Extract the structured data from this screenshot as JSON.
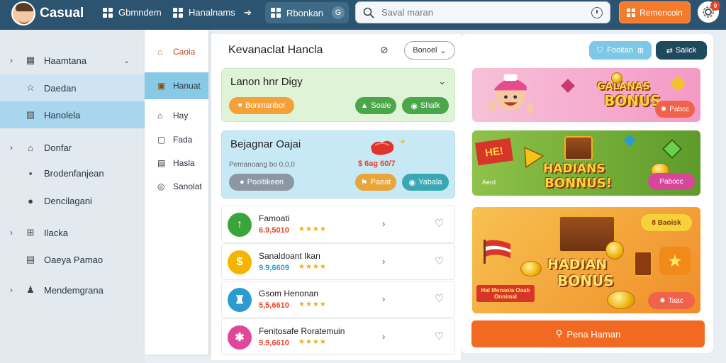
{
  "app": {
    "name": "Casual"
  },
  "topbar": {
    "nav1": "Gbmndem",
    "nav2": "Hanalnams",
    "pill": "Rbonkan",
    "search_placeholder": "Saval maran",
    "cta": "Remencoin",
    "badge": "0"
  },
  "sidebar": {
    "items": [
      {
        "label": "Haamtana",
        "icon": "calendar-icon",
        "chevron": true,
        "dropdown": true
      },
      {
        "label": "Daedan",
        "icon": "star-icon",
        "chevron": false
      },
      {
        "label": "Hanolela",
        "icon": "columns-icon",
        "chevron": false
      },
      {
        "label": "Donfar",
        "icon": "home-icon",
        "chevron": true
      },
      {
        "label": "Brodenfanjean",
        "icon": "lock-icon",
        "chevron": false
      },
      {
        "label": "Dencilagani",
        "icon": "cylinder-icon",
        "chevron": false
      },
      {
        "label": "Ilacka",
        "icon": "grid-icon",
        "chevron": true
      },
      {
        "label": "Oaeya Pamao",
        "icon": "document-icon",
        "chevron": false
      },
      {
        "label": "Mendemgrana",
        "icon": "user-icon",
        "chevron": true
      }
    ]
  },
  "midnav": {
    "items": [
      {
        "label": "Caoia"
      },
      {
        "label": "Hanuat"
      },
      {
        "label": "Hay"
      },
      {
        "label": "Fada"
      },
      {
        "label": "Hasla"
      },
      {
        "label": "Sanolat"
      }
    ]
  },
  "main": {
    "title": "Kevanaclat Hancla",
    "section_btn": "Bonoel",
    "card1": {
      "title": "Lanon hnr Digy",
      "btn1": "Bonmanbor",
      "btn2": "Soale",
      "btn3": "Shalk"
    },
    "card2": {
      "title": "Bejagnar Oajai",
      "subtitle": "Pemanoang bo 0,0,0",
      "price": "$ 6ag 60/7",
      "btn1": "Pooltikeen",
      "btn2": "Paeat",
      "btn3": "Yabala"
    },
    "games": [
      {
        "name": "Famoati",
        "score": "6.9,5010",
        "stars": "★★★★",
        "color": "#3aa53a"
      },
      {
        "name": "Sanaldoant Ikan",
        "score": "9.9,6609",
        "stars": "★★★★",
        "color": "#f5b400"
      },
      {
        "name": "Gsom Henonan",
        "score": "5,5,6610",
        "stars": "★★★★",
        "color": "#2b9bd0"
      },
      {
        "name": "Fenitosafe Roratemuin",
        "score": "9.9,6610",
        "stars": "★★★★",
        "color": "#e0479a"
      }
    ]
  },
  "right": {
    "btn1": "Fooitan",
    "btn2": "Saiick",
    "banner1": {
      "title": "BONUS",
      "subtitle": "GALANAS",
      "btn": "Pabcc"
    },
    "banner2": {
      "title1": "HADIANS",
      "title2": "BONNUS!",
      "tag": "HE!",
      "small": "Aerd",
      "btn": "Pabocc"
    },
    "banner3": {
      "title1": "HADIAN",
      "title2": "BONUS",
      "pill": "8 Baoisk",
      "small": "Hal Menaoia Oaab Onnimal",
      "btn": "Taac"
    },
    "bottom_btn": "Pena Haman"
  },
  "colors": {
    "topbar": "#2c5470",
    "accent": "#f47a2c",
    "sidebar": "#e2e9ef",
    "active": "#88c9e6"
  }
}
